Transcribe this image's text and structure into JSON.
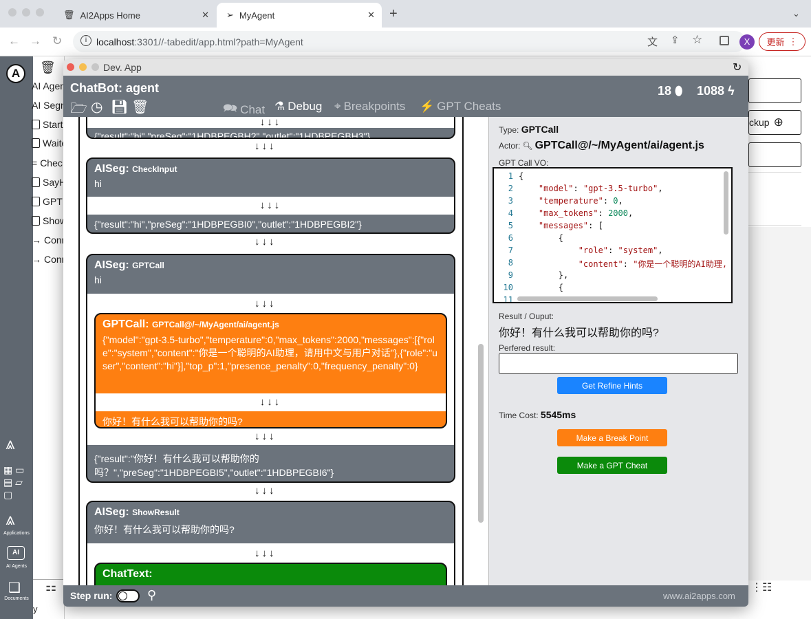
{
  "browser": {
    "tabs": [
      {
        "title": "AI2Apps Home",
        "active": false
      },
      {
        "title": "MyAgent",
        "active": true
      }
    ],
    "url_host": "localhost",
    "url_rest": ":3301//-tabedit/app.html?path=MyAgent",
    "update_label": "更新",
    "profile_initial": "X",
    "colors": {
      "update": "#c5221f",
      "profile": "#7b3fb6"
    }
  },
  "bg_app": {
    "items": [
      "AI Agen",
      "AI Segn",
      "Start",
      "Waite",
      "Chec",
      "SayH",
      "GPT",
      "Show",
      "Conn",
      "Conn"
    ],
    "right_fragments": [
      "ckup"
    ],
    "rail_labels": [
      "Applications",
      "AI Agents",
      "Documents"
    ],
    "bottom_fragment": "y"
  },
  "dialog": {
    "window_title": "Dev. App",
    "app_title": "ChatBot: agent",
    "counter1": "18",
    "counter2": "1088",
    "tabs": [
      "Chat",
      "Debug",
      "Breakpoints",
      "GPT Cheats"
    ],
    "active_tab": "Debug",
    "footer": {
      "step_run_label": "Step run:",
      "site": "www.ai2apps.com"
    }
  },
  "trace": {
    "top_result": "{\"result\":\"hi\",\"preSeg\":\"1HDBPEGBH2\",\"outlet\":\"1HDBPEGBH3\"}",
    "segs": [
      {
        "kind": "AISeg:",
        "name": "CheckInput",
        "input": "hi",
        "result": "{\"result\":\"hi\",\"preSeg\":\"1HDBPEGBI0\",\"outlet\":\"1HDBPEGBI2\"}"
      },
      {
        "kind": "AISeg:",
        "name": "GPTCall",
        "input": "hi",
        "gpt": {
          "kind": "GPTCall:",
          "name": "GPTCall@/~/MyAgent/ai/agent.js",
          "vo": "{\"model\":\"gpt-3.5-turbo\",\"temperature\":0,\"max_tokens\":2000,\"messages\":[{\"role\":\"system\",\"content\":\"你是一个聪明的AI助理，请用中文与用户对话\"},{\"role\":\"user\",\"content\":\"hi\"}],\"top_p\":1,\"presence_penalty\":0,\"frequency_penalty\":0}",
          "output": "你好！有什么我可以帮助你的吗?"
        },
        "result": "{\"result\":\"你好！有什么我可以帮助你的吗？\",\"preSeg\":\"1HDBPEGBI5\",\"outlet\":\"1HDBPEGBI6\"}"
      },
      {
        "kind": "AISeg:",
        "name": "ShowResult",
        "input": "你好！有什么我可以帮助你的吗?",
        "child_kind": "ChatText:"
      }
    ],
    "arrows": "↓↓↓"
  },
  "detail": {
    "type_label": "Type:",
    "type_value": "GPTCall",
    "actor_label": "Actor:",
    "actor_value": "GPTCall@/~/MyAgent/ai/agent.js",
    "vo_label": "GPT Call VO:",
    "code_lines": [
      {
        "n": "1",
        "t": "{"
      },
      {
        "n": "2",
        "t": "    \"model\": \"gpt-3.5-turbo\","
      },
      {
        "n": "3",
        "t": "    \"temperature\": 0,"
      },
      {
        "n": "4",
        "t": "    \"max_tokens\": 2000,"
      },
      {
        "n": "5",
        "t": "    \"messages\": ["
      },
      {
        "n": "6",
        "t": "        {"
      },
      {
        "n": "7",
        "t": "            \"role\": \"system\","
      },
      {
        "n": "8",
        "t": "            \"content\": \"你是一个聪明的AI助理,"
      },
      {
        "n": "9",
        "t": "        },"
      },
      {
        "n": "10",
        "t": "        {"
      },
      {
        "n": "11",
        "t": ""
      }
    ],
    "result_label": "Result / Ouput:",
    "result_value": "你好！有什么我可以帮助你的吗?",
    "preferred_label": "Perfered result:",
    "preferred_value": "",
    "refine_button": "Get Refine Hints",
    "time_label": "Time Cost:",
    "time_value": "5545ms",
    "breakpoint_button": "Make a Break Point",
    "cheat_button": "Make a GPT Cheat",
    "colors": {
      "refine": "#1a84ff",
      "breakpoint": "#fe7f11",
      "cheat": "#0b8a0b",
      "gpt": "#fe7f11",
      "chattext": "#0b8a0b",
      "seg": "#6b737c"
    }
  }
}
